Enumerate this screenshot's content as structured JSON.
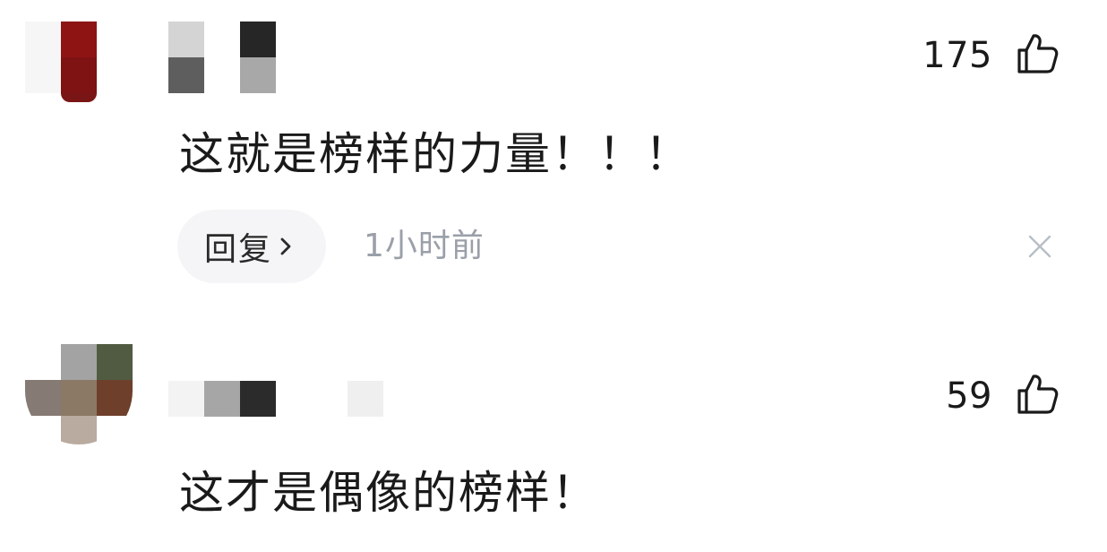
{
  "comments": [
    {
      "likes": "175",
      "text": "这就是榜样的力量！！！",
      "reply_label": "回复",
      "time": "1小时前",
      "avatar_pixels": [
        "#f6f6f6",
        "#8e1414",
        "#ffffff",
        "#f6f6f6",
        "#7f1212",
        "#ffffff"
      ],
      "username_pixels": [
        "#d4d4d4",
        "#ffffff",
        "#262626",
        "#5e5e5e",
        "#ffffff",
        "#a8a8a8"
      ]
    },
    {
      "likes": "59",
      "text": "这才是偶像的榜样！",
      "avatar_pixels": [
        "#ffffff",
        "#a3a3a3",
        "#515b41",
        "#857a74",
        "#8b7865",
        "#6e3f2b",
        "#ffffff",
        "#b9aba0",
        "#ffffff"
      ],
      "username_pixels": [
        "#f3f3f3",
        "#a6a6a6",
        "#2b2b2b",
        "#ffffff",
        "#ffffff",
        "#efefef"
      ]
    }
  ],
  "colors": {
    "reply_bg": "#f5f5f7",
    "timestamp": "#9a9fa8",
    "dismiss": "#b8bec6",
    "text": "#1a1a1a"
  },
  "icons": {
    "like": "thumbs-up-icon",
    "reply_chevron": "chevron-right-icon",
    "dismiss": "close-icon"
  }
}
